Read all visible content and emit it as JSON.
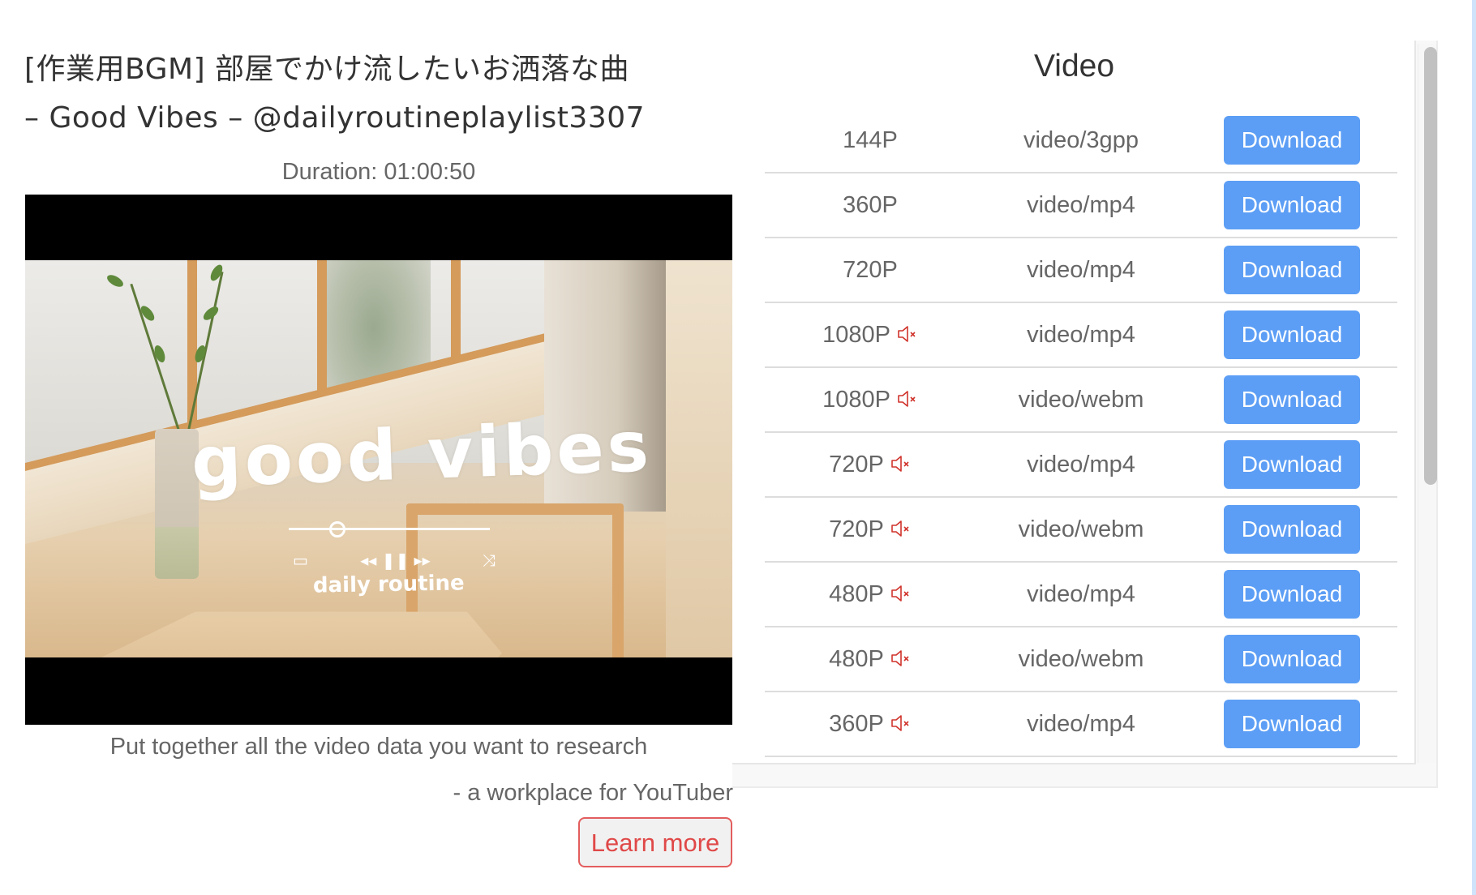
{
  "video_info": {
    "title_line1": "[作業用BGM] 部屋でかけ流したいお洒落な曲",
    "title_line2": "– Good Vibes – @dailyroutineplaylist3307",
    "duration": "Duration: 01:00:50",
    "thumbnail": {
      "headline": "good vibes",
      "subtitle": "daily routine",
      "controls": [
        "repeat-icon",
        "rewind-icon",
        "pause-icon",
        "forward-icon",
        "shuffle-icon"
      ]
    }
  },
  "promo": {
    "tagline": "Put together all the video data you want to research",
    "byline": "- a workplace for YouTuber",
    "learn_more_label": "Learn more"
  },
  "video_panel": {
    "heading": "Video",
    "download_label": "Download",
    "colors": {
      "button": "#5c9ef5",
      "muted_icon": "#d0342c",
      "learn_more": "#e04848"
    },
    "rows": [
      {
        "resolution": "144P",
        "format": "video/3gpp",
        "no_audio": false
      },
      {
        "resolution": "360P",
        "format": "video/mp4",
        "no_audio": false
      },
      {
        "resolution": "720P",
        "format": "video/mp4",
        "no_audio": false
      },
      {
        "resolution": "1080P",
        "format": "video/mp4",
        "no_audio": true
      },
      {
        "resolution": "1080P",
        "format": "video/webm",
        "no_audio": true
      },
      {
        "resolution": "720P",
        "format": "video/mp4",
        "no_audio": true
      },
      {
        "resolution": "720P",
        "format": "video/webm",
        "no_audio": true
      },
      {
        "resolution": "480P",
        "format": "video/mp4",
        "no_audio": true
      },
      {
        "resolution": "480P",
        "format": "video/webm",
        "no_audio": true
      },
      {
        "resolution": "360P",
        "format": "video/mp4",
        "no_audio": true
      },
      {
        "resolution": "",
        "format": "",
        "no_audio": false
      }
    ]
  }
}
